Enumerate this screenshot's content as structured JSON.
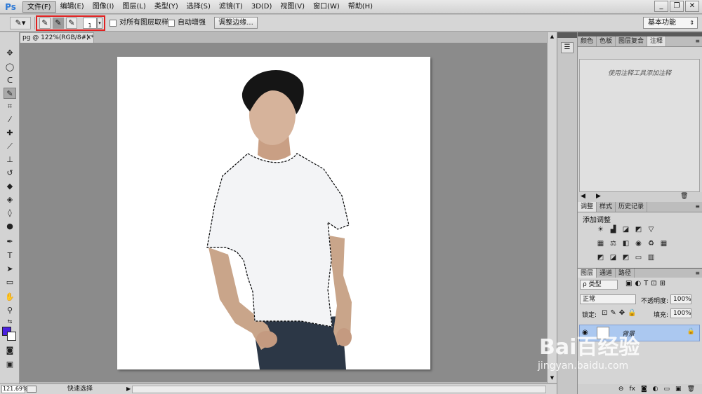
{
  "app": {
    "logo": "Ps"
  },
  "menu": [
    "文件(F)",
    "编辑(E)",
    "图像(I)",
    "图层(L)",
    "类型(Y)",
    "选择(S)",
    "滤镜(T)",
    "3D(D)",
    "视图(V)",
    "窗口(W)",
    "帮助(H)"
  ],
  "window_controls": {
    "minimize": "_",
    "restore": "❐",
    "close": "✕"
  },
  "options": {
    "brush_size": "1",
    "sample_all_layers": "对所有图层取样",
    "auto_enhance": "自动增强",
    "refine_edge": "调整边缘...",
    "workspace": "基本功能"
  },
  "document": {
    "tab_title": "pg @ 122%(RGB/8#) *",
    "zoom": "121.69%",
    "status_text": "快速选择"
  },
  "panels": {
    "top_tabs": [
      "颜色",
      "色板",
      "图层复合",
      "注释"
    ],
    "notes_hint": "使用注释工具添加注释",
    "adj_tabs": [
      "调整",
      "样式",
      "历史记录"
    ],
    "adj_title": "添加调整",
    "layers_tabs": [
      "图层",
      "通道",
      "路径"
    ],
    "filter_kind": "ρ 类型",
    "blend_mode": "正常",
    "opacity_label": "不透明度:",
    "opacity_value": "100%",
    "lock_label": "锁定:",
    "fill_label": "填充:",
    "fill_value": "100%",
    "layer_name": "背景"
  },
  "watermark": {
    "main": "Bai百经验",
    "sub": "jingyan.baidu.com"
  }
}
